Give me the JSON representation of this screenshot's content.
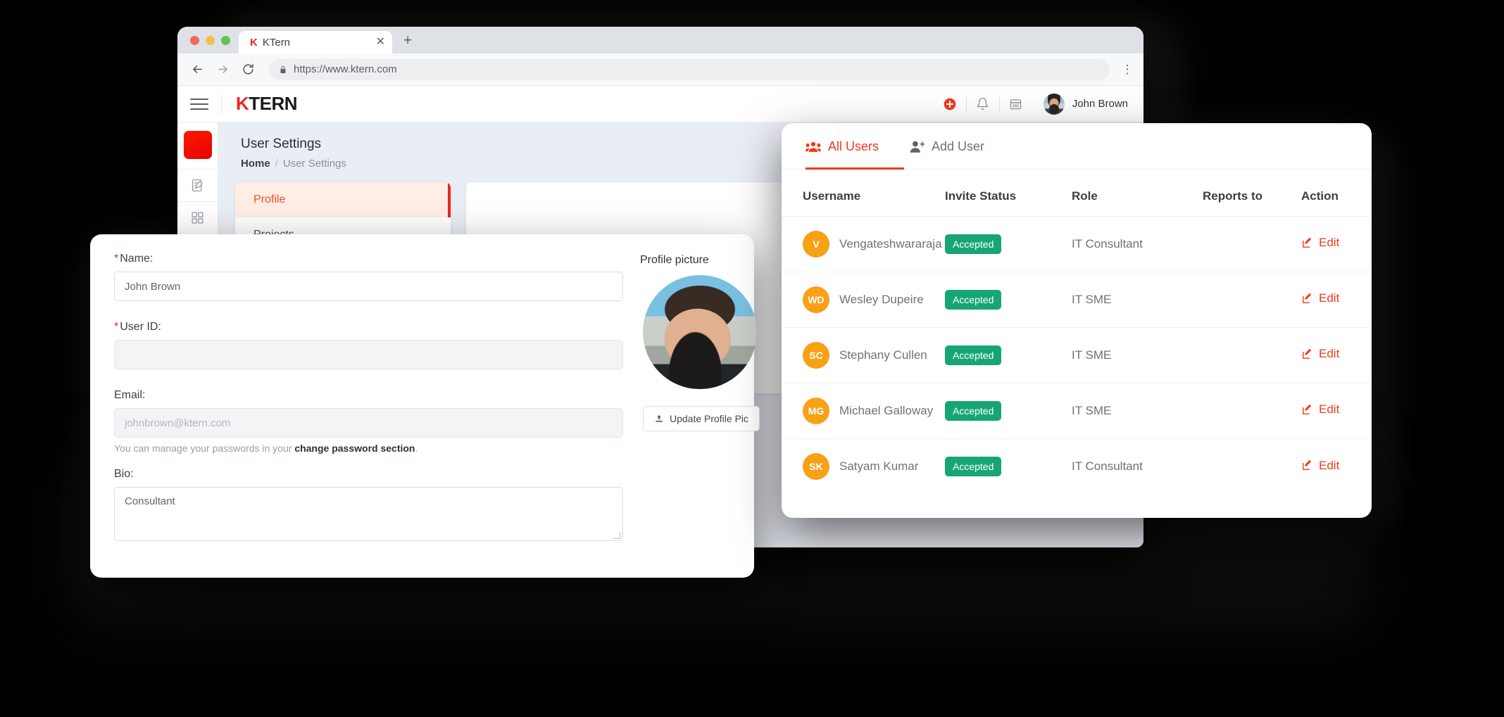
{
  "browser": {
    "tab": {
      "title": "KTern",
      "favicon_icon": "ktern-favicon",
      "close_icon": "close-icon"
    },
    "new_tab_icon": "plus-icon",
    "back_icon": "back-arrow-icon",
    "forward_icon": "forward-arrow-icon",
    "reload_icon": "reload-icon",
    "lock_icon": "lock-icon",
    "url": "https://www.ktern.com",
    "menu_icon": "kebab-menu-icon"
  },
  "appbar": {
    "menu_icon": "hamburger-icon",
    "logo_first": "K",
    "logo_rest": "TERN",
    "help_icon": "help-plus-icon",
    "bell_icon": "notification-bell-icon",
    "calendar_icon": "calendar-icon",
    "avatar_icon": "user-avatar",
    "user_name": "John Brown"
  },
  "page": {
    "title": "User Settings",
    "breadcrumb_home": "Home",
    "breadcrumb_sep": "/",
    "breadcrumb_current": "User Settings",
    "rail": {
      "logo_name": "ktern-square-logo",
      "items": [
        {
          "icon": "edit-document-icon"
        },
        {
          "icon": "grid-apps-icon"
        }
      ]
    },
    "settings_nav": [
      {
        "label": "Profile",
        "active": true
      },
      {
        "label": "Projects",
        "active": false
      }
    ]
  },
  "profile_card": {
    "name": {
      "label": "Name:",
      "required": "*",
      "value": "John Brown"
    },
    "user_id": {
      "label": "User ID:",
      "required": "*",
      "value": ""
    },
    "email": {
      "label": "Email:",
      "placeholder": "johnbrown@ktern.com",
      "hint_prefix": "You can manage your passwords in your ",
      "hint_link": "change password section",
      "hint_suffix": "."
    },
    "bio": {
      "label": "Bio:",
      "value": "Consultant"
    },
    "picture": {
      "label": "Profile picture",
      "avatar_icon": "profile-photo",
      "update_button": "Update Profile Pic",
      "upload_icon": "upload-icon"
    }
  },
  "users_panel": {
    "tabs": [
      {
        "label": "All Users",
        "icon": "users-group-icon",
        "active": true
      },
      {
        "label": "Add User",
        "icon": "user-plus-icon",
        "active": false
      }
    ],
    "columns": [
      "Username",
      "Invite Status",
      "Role",
      "Reports to",
      "Action"
    ],
    "action_label": "Edit",
    "action_icon": "edit-pencil-icon",
    "badge_color": "#17a673",
    "accent_color": "#f4391b",
    "initials_color": "#f7a116",
    "rows": [
      {
        "initials": "V",
        "username": "Vengateshwararaja",
        "status": "Accepted",
        "role": "IT Consultant",
        "reports_to_icon": "avatar-male",
        "action": "Edit"
      },
      {
        "initials": "WD",
        "username": "Wesley Dupeire",
        "status": "Accepted",
        "role": "IT SME",
        "reports_to_icon": "avatar-female",
        "action": "Edit"
      },
      {
        "initials": "SC",
        "username": "Stephany Cullen",
        "status": "Accepted",
        "role": "IT SME",
        "reports_to_icon": "avatar-female",
        "action": "Edit"
      },
      {
        "initials": "MG",
        "username": "Michael Galloway",
        "status": "Accepted",
        "role": "IT SME",
        "reports_to_icon": "avatar-female",
        "action": "Edit"
      },
      {
        "initials": "SK",
        "username": "Satyam Kumar",
        "status": "Accepted",
        "role": "IT Consultant",
        "reports_to_icon": "avatar-male",
        "action": "Edit"
      }
    ]
  }
}
